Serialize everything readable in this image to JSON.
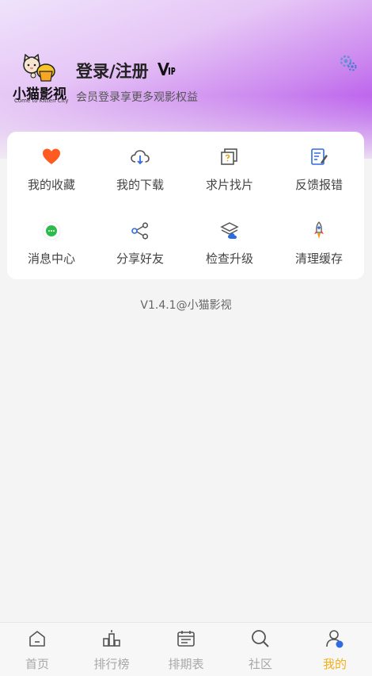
{
  "header": {
    "logo_text": "小猫影视",
    "logo_subtext": "Come to Kitten City",
    "login_title": "登录/注册",
    "vip_badge": "VIP",
    "login_subtitle": "会员登录享更多观影权益",
    "settings_icon": "gear-icon"
  },
  "menu": {
    "items": [
      {
        "label": "我的收藏",
        "icon": "heart-icon",
        "color": "#ff5a1f"
      },
      {
        "label": "我的下载",
        "icon": "cloud-download-icon",
        "color": "#555555"
      },
      {
        "label": "求片找片",
        "icon": "question-doc-icon",
        "color": "#555555"
      },
      {
        "label": "反馈报错",
        "icon": "feedback-pen-icon",
        "color": "#2f6ce0"
      },
      {
        "label": "消息中心",
        "icon": "message-icon",
        "color": "#2dbb4e"
      },
      {
        "label": "分享好友",
        "icon": "share-icon",
        "color": "#2f6ce0"
      },
      {
        "label": "检查升级",
        "icon": "upgrade-layers-icon",
        "color": "#2f6ce0"
      },
      {
        "label": "清理缓存",
        "icon": "rocket-icon",
        "color": "#e98c1c"
      }
    ]
  },
  "version": "V1.4.1@小猫影视",
  "tabbar": {
    "tabs": [
      {
        "label": "首页",
        "icon": "home-icon",
        "active": false
      },
      {
        "label": "排行榜",
        "icon": "ranking-icon",
        "active": false
      },
      {
        "label": "排期表",
        "icon": "calendar-icon",
        "active": false
      },
      {
        "label": "社区",
        "icon": "search-icon",
        "active": false
      },
      {
        "label": "我的",
        "icon": "profile-icon",
        "active": true
      }
    ],
    "active_color": "#f2b01e",
    "inactive_color": "#a8a8a8"
  }
}
